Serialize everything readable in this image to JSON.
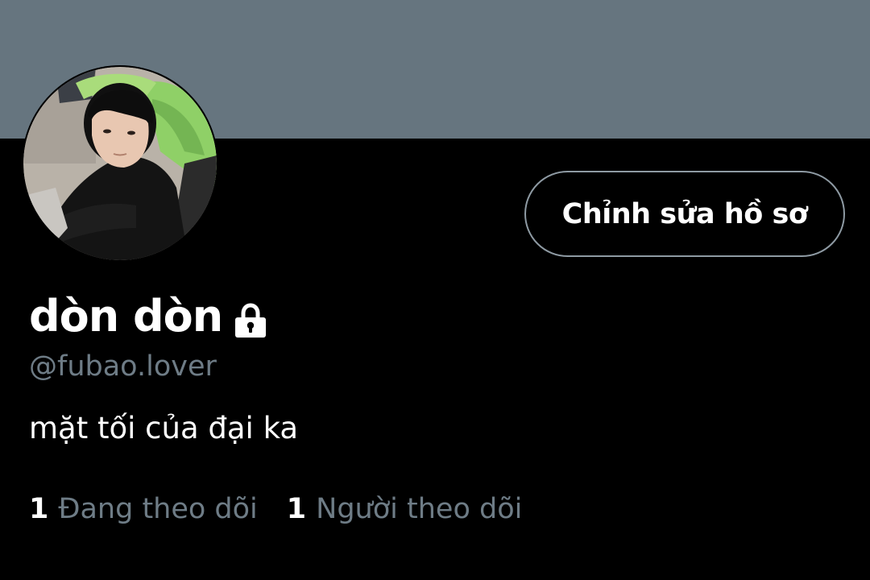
{
  "profile": {
    "banner_color": "#66757f",
    "avatar_alt": "profile photo",
    "display_name": "dòn dòn",
    "protected_icon": "lock-icon",
    "handle": "@fubao.lover",
    "bio": "mặt tối của đại ka"
  },
  "actions": {
    "edit_profile_label": "Chỉnh sửa hồ sơ"
  },
  "stats": {
    "following_count": "1",
    "following_label": "Đang theo dõi",
    "followers_count": "1",
    "followers_label": "Người theo dõi"
  },
  "colors": {
    "background": "#000000",
    "primary_text": "#ffffff",
    "secondary_text": "#6e7c86",
    "button_border": "#8e9aa3"
  }
}
